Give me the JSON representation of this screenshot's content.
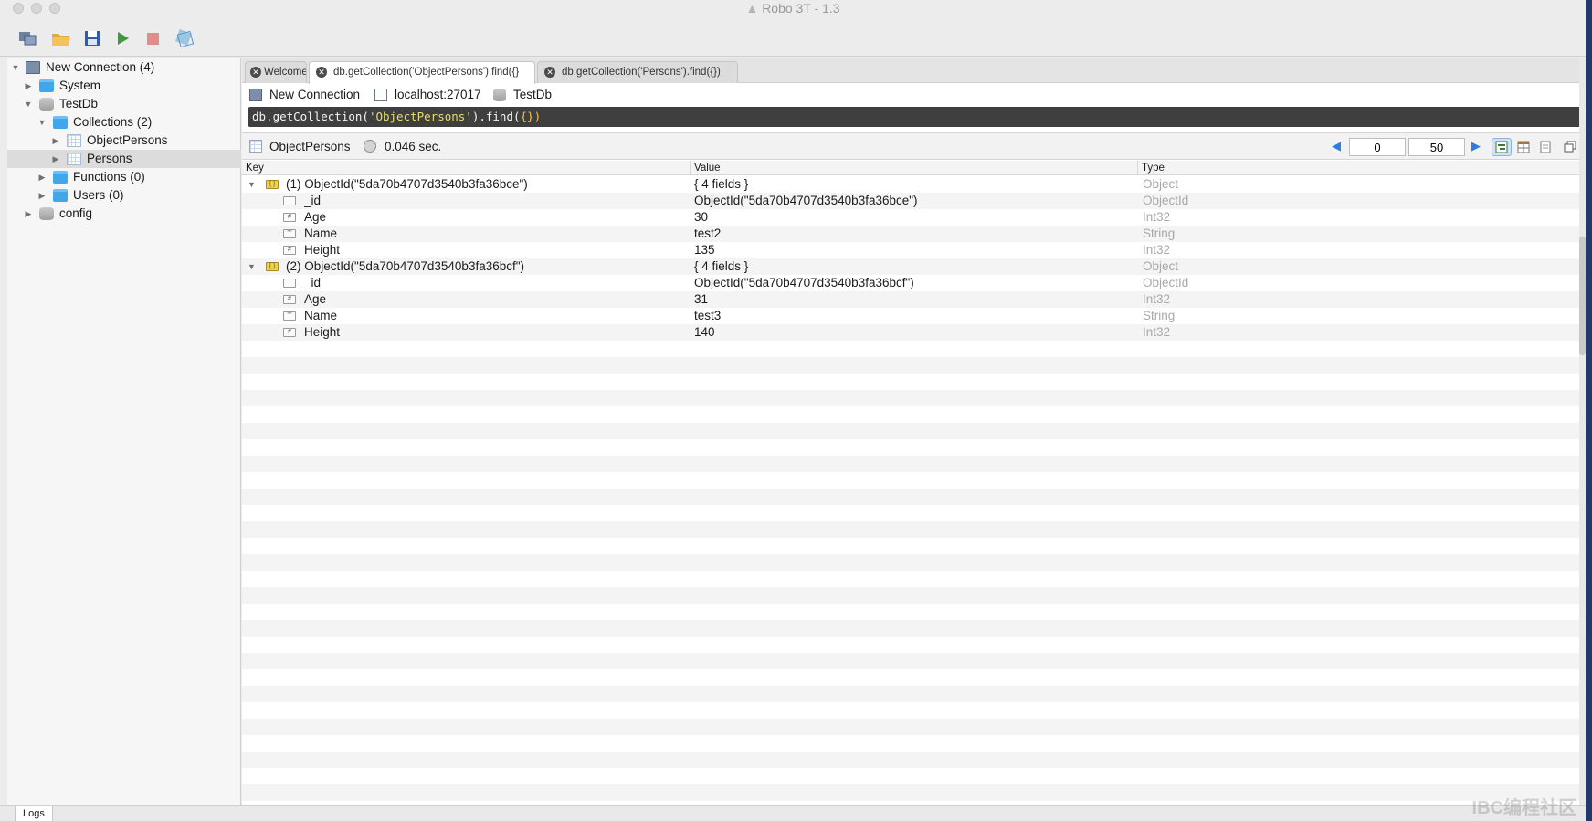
{
  "app": {
    "title": "Robo 3T - 1.3"
  },
  "tree": {
    "items": [
      {
        "label": "New Connection (4)",
        "icon": "monitor-icon",
        "level": 0,
        "expanded": true
      },
      {
        "label": "System",
        "icon": "folder-icon",
        "level": 1,
        "expanded": false
      },
      {
        "label": "TestDb",
        "icon": "database-icon",
        "level": 1,
        "expanded": true
      },
      {
        "label": "Collections (2)",
        "icon": "folder-icon",
        "level": 2,
        "expanded": true
      },
      {
        "label": "ObjectPersons",
        "icon": "collection-icon",
        "level": 3,
        "expanded": false
      },
      {
        "label": "Persons",
        "icon": "collection-icon",
        "level": 3,
        "expanded": false,
        "selected": true
      },
      {
        "label": "Functions (0)",
        "icon": "folder-icon",
        "level": 2,
        "expanded": false
      },
      {
        "label": "Users (0)",
        "icon": "folder-icon",
        "level": 2,
        "expanded": false
      },
      {
        "label": "config",
        "icon": "database-icon",
        "level": 1,
        "expanded": false
      }
    ]
  },
  "tabs": [
    {
      "label": "Welcome",
      "active": false
    },
    {
      "label": "db.getCollection('ObjectPersons').find({}",
      "active": true
    },
    {
      "label": "db.getCollection('Persons').find({})",
      "active": false
    }
  ],
  "connection": {
    "name": "New Connection",
    "host": "localhost:27017",
    "database": "TestDb"
  },
  "query": {
    "prefix": "db.getCollection(",
    "collection": "'ObjectPersons'",
    "middle": ").find(",
    "args": "{}",
    "suffix": ")"
  },
  "result": {
    "collection": "ObjectPersons",
    "elapsed": "0.046 sec.",
    "skip": "0",
    "limit": "50"
  },
  "grid": {
    "columns": [
      "Key",
      "Value",
      "Type"
    ],
    "rows": [
      {
        "key": "(1) ObjectId(\"5da70b4707d3540b3fa36bce\")",
        "value": "{ 4 fields }",
        "type": "Object",
        "depth": 0,
        "icon": "object-icon"
      },
      {
        "key": "_id",
        "value": "ObjectId(\"5da70b4707d3540b3fa36bce\")",
        "type": "ObjectId",
        "depth": 1,
        "icon": "objectid-icon"
      },
      {
        "key": "Age",
        "value": "30",
        "type": "Int32",
        "depth": 1,
        "icon": "number-icon"
      },
      {
        "key": "Name",
        "value": "test2",
        "type": "String",
        "depth": 1,
        "icon": "string-icon"
      },
      {
        "key": "Height",
        "value": "135",
        "type": "Int32",
        "depth": 1,
        "icon": "number-icon"
      },
      {
        "key": "(2) ObjectId(\"5da70b4707d3540b3fa36bcf\")",
        "value": "{ 4 fields }",
        "type": "Object",
        "depth": 0,
        "icon": "object-icon"
      },
      {
        "key": "_id",
        "value": "ObjectId(\"5da70b4707d3540b3fa36bcf\")",
        "type": "ObjectId",
        "depth": 1,
        "icon": "objectid-icon"
      },
      {
        "key": "Age",
        "value": "31",
        "type": "Int32",
        "depth": 1,
        "icon": "number-icon"
      },
      {
        "key": "Name",
        "value": "test3",
        "type": "String",
        "depth": 1,
        "icon": "string-icon"
      },
      {
        "key": "Height",
        "value": "140",
        "type": "Int32",
        "depth": 1,
        "icon": "number-icon"
      }
    ]
  },
  "logs": {
    "label": "Logs"
  },
  "watermark": "IBC编程社区",
  "colors": {
    "query_bg": "#3f3f3f",
    "folder": "#41a7ea",
    "type_text": "#a8a8a8",
    "selected_row": "#dcdcdc"
  }
}
